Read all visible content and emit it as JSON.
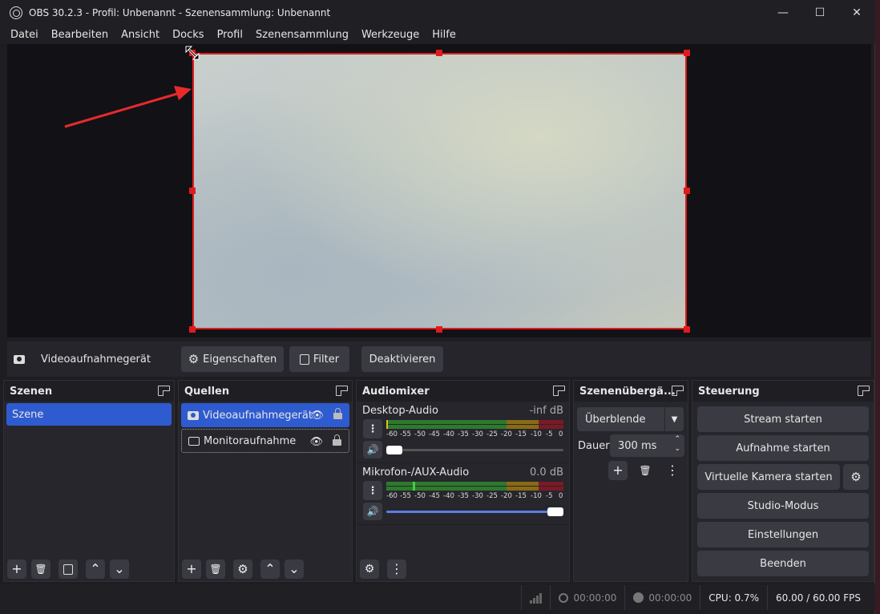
{
  "window": {
    "title": "OBS 30.2.3 - Profil: Unbenannt - Szenensammlung: Unbenannt",
    "controls": {
      "minimize": "—",
      "maximize": "☐",
      "close": "✕"
    }
  },
  "menu": [
    "Datei",
    "Bearbeiten",
    "Ansicht",
    "Docks",
    "Profil",
    "Szenensammlung",
    "Werkzeuge",
    "Hilfe"
  ],
  "source_toolbar": {
    "selected_source": "Videoaufnahmegerät",
    "properties_label": "Eigenschaften",
    "filter_label": "Filter",
    "deactivate_label": "Deaktivieren"
  },
  "scenes": {
    "title": "Szenen",
    "items": [
      "Szene"
    ]
  },
  "sources": {
    "title": "Quellen",
    "items": [
      {
        "name": "Videoaufnahmegerät",
        "icon": "camera-icon",
        "selected": true
      },
      {
        "name": "Monitoraufnahme",
        "icon": "monitor-icon",
        "selected": false
      }
    ]
  },
  "audio": {
    "title": "Audiomixer",
    "ticks": [
      "-60",
      "-55",
      "-50",
      "-45",
      "-40",
      "-35",
      "-30",
      "-25",
      "-20",
      "-15",
      "-10",
      "-5",
      "0"
    ],
    "channels": [
      {
        "name": "Desktop-Audio",
        "level": "-inf dB",
        "volume_fraction": 0.0
      },
      {
        "name": "Mikrofon-/AUX-Audio",
        "level": "0.0 dB",
        "volume_fraction": 1.0
      }
    ]
  },
  "transitions": {
    "title": "Szenenübergä...",
    "selected": "Überblende",
    "duration_label": "Dauer",
    "duration_value": "300 ms"
  },
  "controls": {
    "title": "Steuerung",
    "stream": "Stream starten",
    "record": "Aufnahme starten",
    "virtual_cam": "Virtuelle Kamera starten",
    "studio": "Studio-Modus",
    "settings": "Einstellungen",
    "exit": "Beenden"
  },
  "status": {
    "stream_time": "00:00:00",
    "record_time": "00:00:00",
    "cpu": "CPU: 0.7%",
    "fps": "60.00 / 60.00 FPS"
  },
  "colors": {
    "accent": "#2f5bd0",
    "selection": "#e01b1b"
  }
}
